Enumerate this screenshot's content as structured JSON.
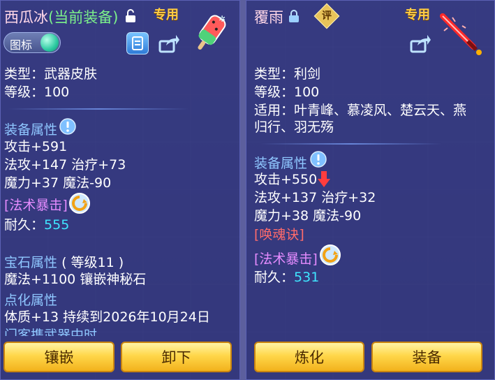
{
  "left": {
    "title_name": "西瓜冰",
    "title_status": "(当前装备)",
    "exclusive_tag": "专用",
    "icon_toggle_label": "图标",
    "type_line": "类型：武器皮肤",
    "level_line": "等级：100",
    "equip_attr_header": "装备属性",
    "attr_1": "攻击+591",
    "attr_2": "法攻+147 治疗+73",
    "attr_3": "魔力+37 魔法-90",
    "special": "[法术暴击]",
    "durability_label": "耐久：",
    "durability_value": "555",
    "gem_header": "宝石属性",
    "gem_level": "( 等级11 )",
    "gem_line": "魔法+1100 镶嵌神秘石",
    "spot_header": "点化属性",
    "spot_line": "体质+13 持续到2026年10月24日",
    "partial_line": "门客携武器中时",
    "buttons": [
      "镶嵌",
      "卸下"
    ]
  },
  "right": {
    "title_name": "覆雨",
    "exclusive_tag": "专用",
    "rate_badge": "评",
    "type_line": "类型：利剑",
    "level_line": "等级：100",
    "suit_line_1": "适用：叶青峰、慕凌风、楚云天、燕",
    "suit_line_2": "归行、羽无殇",
    "equip_attr_header": "装备属性",
    "attr_1": "攻击+550",
    "attr_2": "法攻+137 治疗+32",
    "attr_3": "魔力+38 魔法-90",
    "special_red": "[唤魂诀]",
    "special": "[法术暴击]",
    "durability_label": "耐久：",
    "durability_value": "531",
    "buttons": [
      "炼化",
      "装备"
    ]
  },
  "colors": {
    "accent_gold": "#ffd74a",
    "cyan": "#3fe5ff",
    "purple": "#e58cff",
    "green": "#7cf28a",
    "red": "#ff6b6b"
  }
}
